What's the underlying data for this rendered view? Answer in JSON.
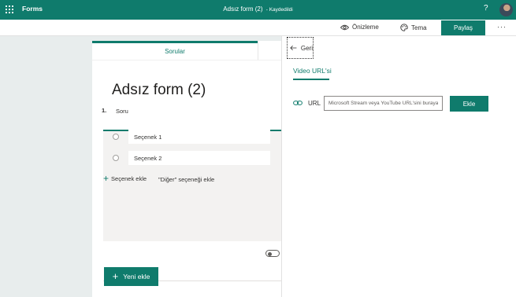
{
  "header": {
    "app_name": "Forms",
    "form_title": "Adsız form (2)",
    "saved_status": "- Kaydedildi",
    "help_label": "?"
  },
  "commands": {
    "preview_label": "Önizleme",
    "theme_label": "Tema",
    "share_label": "Paylaş",
    "more_label": "···"
  },
  "editor": {
    "tab_label": "Sorular",
    "title": "Adsız form (2)",
    "question": {
      "number": "1.",
      "text": "Soru",
      "options": [
        "Seçenek 1",
        "Seçenek 2"
      ],
      "add_option_label": "Seçenek ekle",
      "add_other_label": "\"Diğer\" seçeneği ekle",
      "required": false
    },
    "new_button_label": "Yeni ekle"
  },
  "panel": {
    "back_label": "Geri",
    "tab_label": "Video URL'si",
    "url_label": "URL",
    "url_placeholder": "Microsoft Stream veya YouTube URL'sini buraya yapıştırın",
    "url_value": "",
    "add_button_label": "Ekle"
  },
  "colors": {
    "accent": "#0f7b6c",
    "page_background": "#e8eded"
  }
}
